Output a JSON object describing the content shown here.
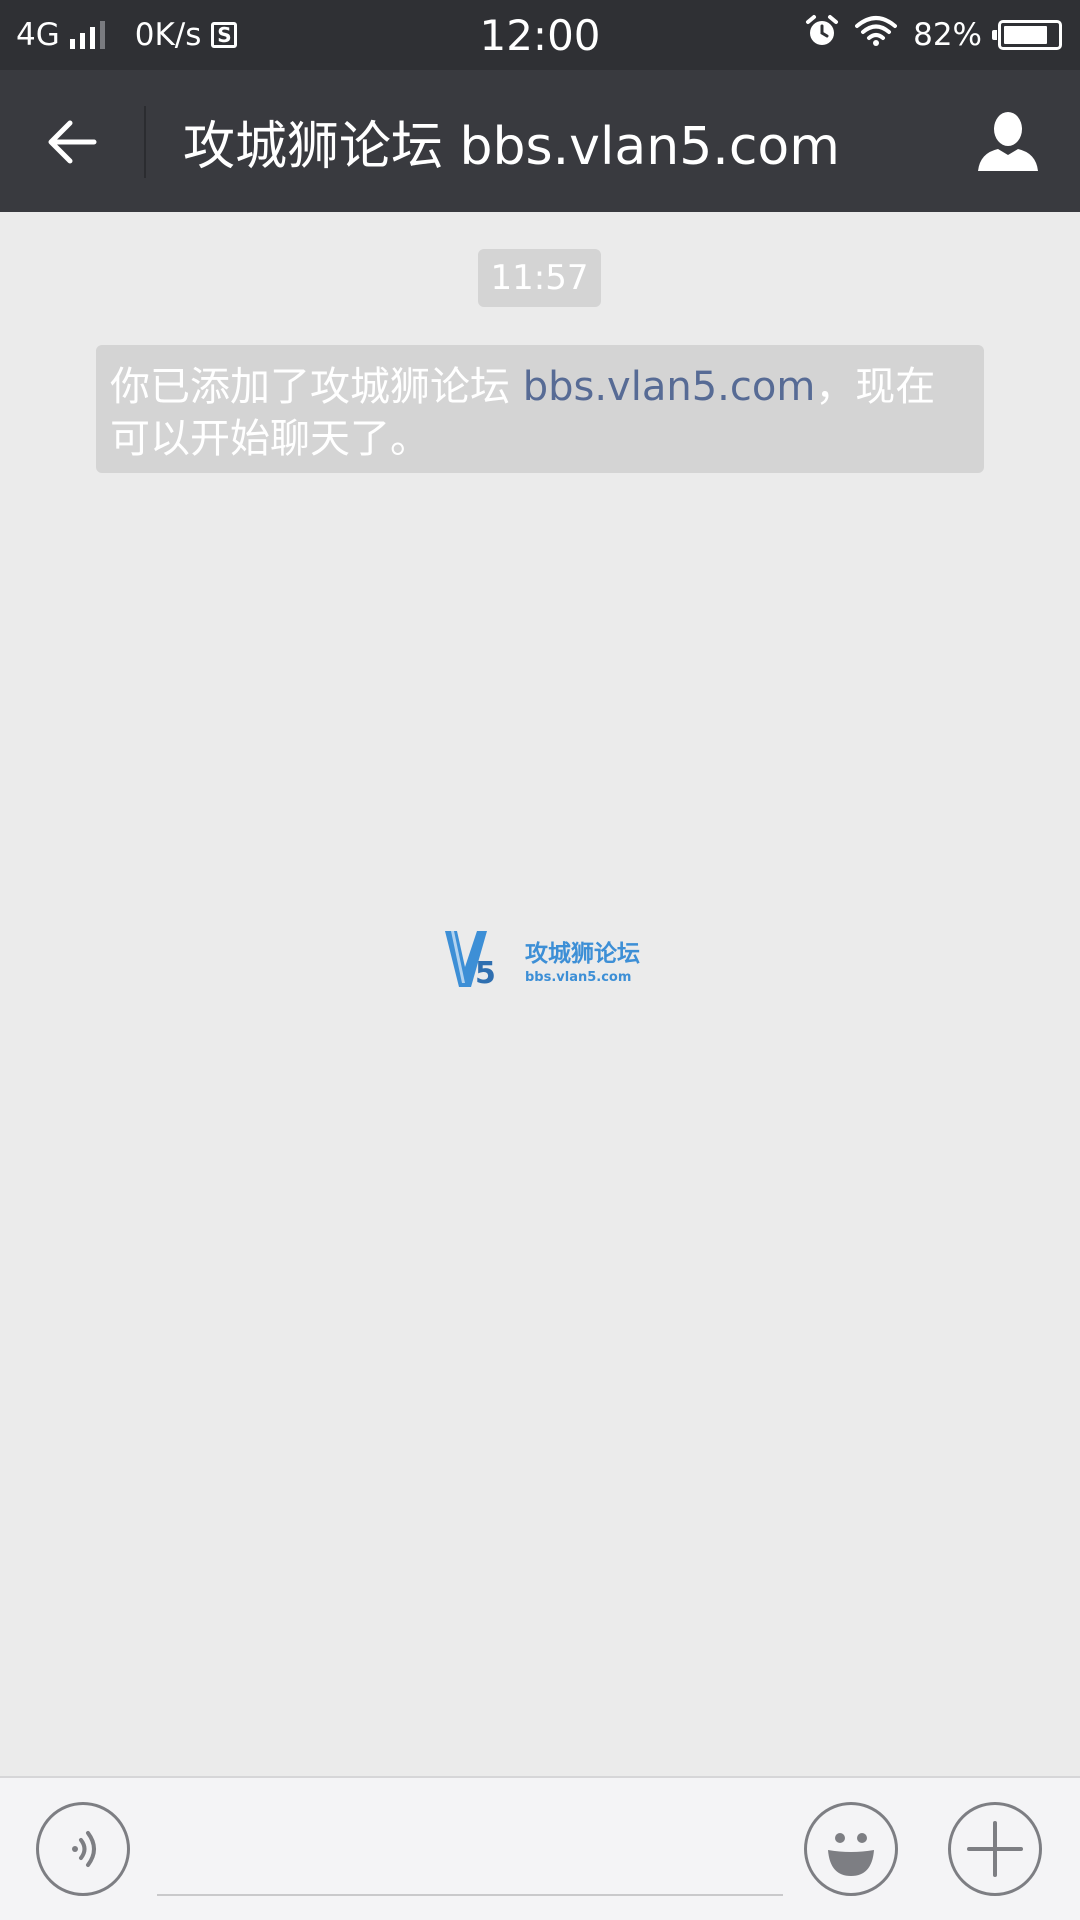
{
  "status_bar": {
    "network": "4G",
    "speed": "0K/s",
    "sim_badge": "S",
    "time": "12:00",
    "battery_percent": "82%",
    "battery_level": 0.82,
    "icons": [
      "signal-icon",
      "sim-icon",
      "alarm-icon",
      "wifi-icon",
      "battery-icon"
    ]
  },
  "nav": {
    "title": "攻城狮论坛 bbs.vlan5.com",
    "back_icon": "back-arrow-icon",
    "profile_icon": "person-icon"
  },
  "chat": {
    "timestamp": "11:57",
    "system_message": {
      "prefix": "你已添加了攻城狮论坛 ",
      "link_text": "bbs.vlan5.com",
      "suffix": "，现在可以开始聊天了。",
      "link_color": "#576b95"
    },
    "watermark": {
      "logo_text": "V5",
      "cn_text": "攻城狮论坛",
      "url_text": "bbs.vlan5.com",
      "color": "#3d8fd6"
    }
  },
  "input_bar": {
    "voice_icon": "voice-icon",
    "emoji_icon": "emoji-icon",
    "plus_icon": "plus-icon",
    "input_value": "",
    "input_placeholder": ""
  },
  "colors": {
    "status_bar_bg": "#2f3034",
    "nav_bg": "#393a3f",
    "chat_bg": "#ebebeb",
    "bubble_bg": "#d4d4d4"
  }
}
